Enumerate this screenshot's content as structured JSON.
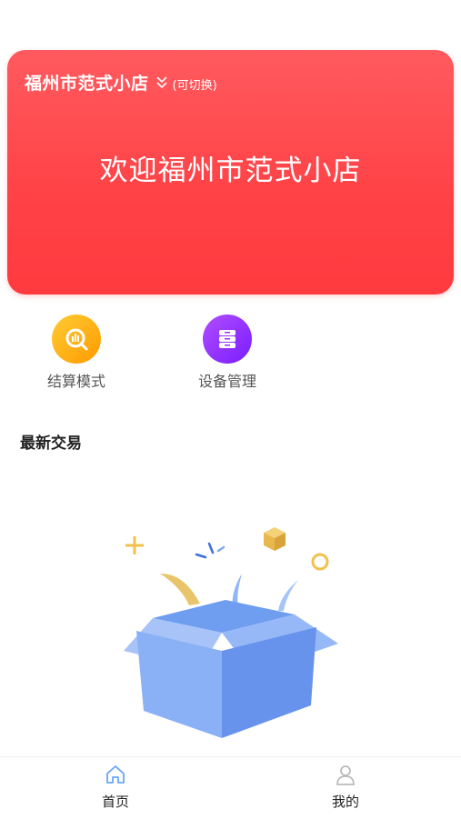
{
  "store": {
    "name": "福州市范式小店",
    "switch_hint": "(可切换)",
    "welcome": "欢迎福州市范式小店"
  },
  "quick_actions": [
    {
      "label": "结算模式",
      "icon": "chart-icon",
      "color": "#ffb300"
    },
    {
      "label": "设备管理",
      "icon": "device-icon",
      "color": "#9b30ff"
    }
  ],
  "section": {
    "title": "最新交易"
  },
  "empty_state": {
    "icon": "empty-box-illustration"
  },
  "tabbar": {
    "items": [
      {
        "label": "首页",
        "icon": "home-icon",
        "active": true
      },
      {
        "label": "我的",
        "icon": "user-icon",
        "active": false
      }
    ]
  },
  "colors": {
    "accent": "#ff4246",
    "tab_active": "#6aa6f8",
    "tab_inactive": "#bbbbbb"
  }
}
